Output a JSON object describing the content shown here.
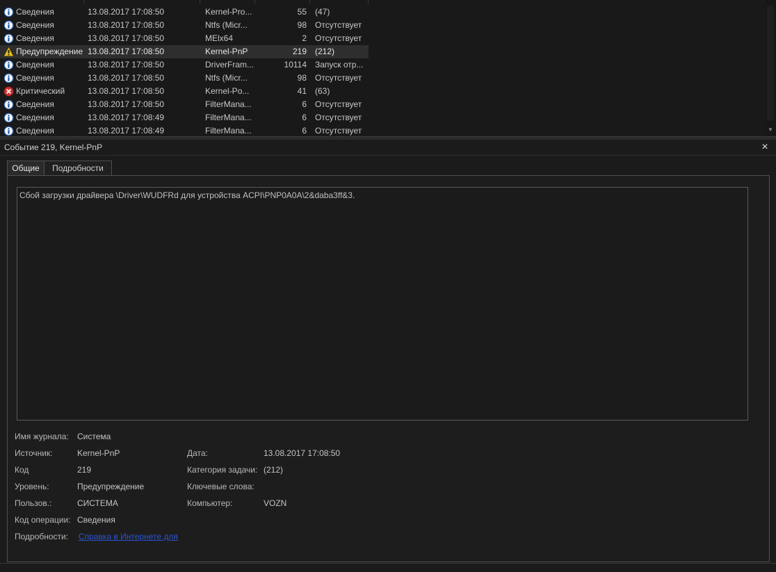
{
  "events": [
    {
      "level": "Сведения",
      "icon": "info-icon",
      "date": "13.08.2017 17:08:50",
      "source": "Kernel-Pro...",
      "id": "55",
      "category": "(47)"
    },
    {
      "level": "Сведения",
      "icon": "info-icon",
      "date": "13.08.2017 17:08:50",
      "source": "Ntfs (Micr...",
      "id": "98",
      "category": "Отсутствует"
    },
    {
      "level": "Сведения",
      "icon": "info-icon",
      "date": "13.08.2017 17:08:50",
      "source": "MElx64",
      "id": "2",
      "category": "Отсутствует"
    },
    {
      "level": "Предупреждение",
      "icon": "warning-icon",
      "date": "13.08.2017 17:08:50",
      "source": "Kernel-PnP",
      "id": "219",
      "category": "(212)",
      "selected": true
    },
    {
      "level": "Сведения",
      "icon": "info-icon",
      "date": "13.08.2017 17:08:50",
      "source": "DriverFram...",
      "id": "10114",
      "category": "Запуск отр..."
    },
    {
      "level": "Сведения",
      "icon": "info-icon",
      "date": "13.08.2017 17:08:50",
      "source": "Ntfs (Micr...",
      "id": "98",
      "category": "Отсутствует"
    },
    {
      "level": "Критический",
      "icon": "critical-icon",
      "date": "13.08.2017 17:08:50",
      "source": "Kernel-Po...",
      "id": "41",
      "category": "(63)"
    },
    {
      "level": "Сведения",
      "icon": "info-icon",
      "date": "13.08.2017 17:08:50",
      "source": "FilterMana...",
      "id": "6",
      "category": "Отсутствует"
    },
    {
      "level": "Сведения",
      "icon": "info-icon",
      "date": "13.08.2017 17:08:49",
      "source": "FilterMana...",
      "id": "6",
      "category": "Отсутствует"
    },
    {
      "level": "Сведения",
      "icon": "info-icon",
      "date": "13.08.2017 17:08:49",
      "source": "FilterMana...",
      "id": "6",
      "category": "Отсутствует"
    }
  ],
  "details": {
    "title": "Событие 219, Kernel-PnP",
    "close_glyph": "×",
    "tabs": [
      "Общие",
      "Подробности"
    ],
    "message": "Сбой загрузки драйвера \\Driver\\WUDFRd для устройства ACPI\\PNP0A0A\\2&daba3ff&3.",
    "fields": {
      "log_name_label": "Имя журнала:",
      "log_name": "Система",
      "source_label": "Источник:",
      "source": "Kernel-PnP",
      "date_label": "Дата:",
      "date": "13.08.2017 17:08:50",
      "code_label": "Код",
      "code": "219",
      "task_category_label": "Категория задачи:",
      "task_category": "(212)",
      "level_label": "Уровень:",
      "level": "Предупреждение",
      "keywords_label": "Ключевые слова:",
      "keywords": "",
      "user_label": "Пользов.:",
      "user": "СИСТЕМА",
      "computer_label": "Компьютер:",
      "computer": "VOZN",
      "opcode_label": "Код операции:",
      "opcode": "Сведения",
      "more_info_label": "Подробности:",
      "more_info_link": "Справка в Интернете для"
    }
  },
  "colors": {
    "background": "#1b1b1b",
    "selected_row": "#2e2e2e",
    "link": "#2a55d8",
    "info": "#3a78c8",
    "warning": "#e8c020",
    "critical": "#d03030"
  }
}
